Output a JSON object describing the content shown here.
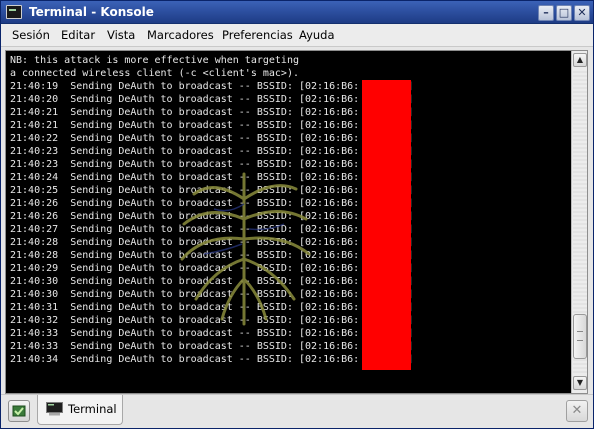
{
  "window": {
    "title": "Terminal - Konsole",
    "buttons": {
      "minimize": "–",
      "maximize": "□",
      "close": "✕"
    }
  },
  "menubar": {
    "items": [
      "Sesión",
      "Editar",
      "Vista",
      "Marcadores",
      "Preferencias",
      "Ayuda"
    ]
  },
  "terminal": {
    "lines": [
      "NB: this attack is more effective when targeting",
      "a connected wireless client (-c <client's mac>).",
      "21:40:19  Sending DeAuth to broadcast -- BSSID: [02:16:B6:        ]",
      "21:40:20  Sending DeAuth to broadcast -- BSSID: [02:16:B6:        ]",
      "21:40:21  Sending DeAuth to broadcast -- BSSID: [02:16:B6:        ]",
      "21:40:21  Sending DeAuth to broadcast -- BSSID: [02:16:B6:        ]",
      "21:40:22  Sending DeAuth to broadcast -- BSSID: [02:16:B6:        ]",
      "21:40:23  Sending DeAuth to broadcast -- BSSID: [02:16:B6:        ]",
      "21:40:23  Sending DeAuth to broadcast -- BSSID: [02:16:B6:        ]",
      "21:40:24  Sending DeAuth to broadcast -- BSSID: [02:16:B6:        ]",
      "21:40:25  Sending DeAuth to broadcast -- BSSID: [02:16:B6:        ]",
      "21:40:26  Sending DeAuth to broadcast -- BSSID: [02:16:B6:        ]",
      "21:40:26  Sending DeAuth to broadcast -- BSSID: [02:16:B6:        ]",
      "21:40:27  Sending DeAuth to broadcast -- BSSID: [02:16:B6:        ]",
      "21:40:28  Sending DeAuth to broadcast -- BSSID: [02:16:B6:        ]",
      "21:40:28  Sending DeAuth to broadcast -- BSSID: [02:16:B6:        ]",
      "21:40:29  Sending DeAuth to broadcast -- BSSID: [02:16:B6:        ]",
      "21:40:30  Sending DeAuth to broadcast -- BSSID: [02:16:B6:        ]",
      "21:40:30  Sending DeAuth to broadcast -- BSSID: [02:16:B6:        ]",
      "21:40:31  Sending DeAuth to broadcast -- BSSID: [02:16:B6:        ]",
      "21:40:32  Sending DeAuth to broadcast -- BSSID: [02:16:B6:        ]",
      "21:40:33  Sending DeAuth to broadcast -- BSSID: [02:16:B6:        ]",
      "21:40:33  Sending DeAuth to broadcast -- BSSID: [02:16:B6:        ]",
      "21:40:34  Sending DeAuth to broadcast -- BSSID: [02:16:B6:        ]"
    ],
    "colors": {
      "background": "#000000",
      "foreground": "#e8e8e8",
      "redaction": "#ff0000"
    }
  },
  "scrollbar": {
    "up_arrow": "▲",
    "down_arrow": "▼"
  },
  "tabbar": {
    "tabs": [
      {
        "label": "Terminal",
        "icon": "terminal-icon"
      }
    ],
    "new_tab_icon": "new-session-icon",
    "close_tab_symbol": "✕"
  }
}
